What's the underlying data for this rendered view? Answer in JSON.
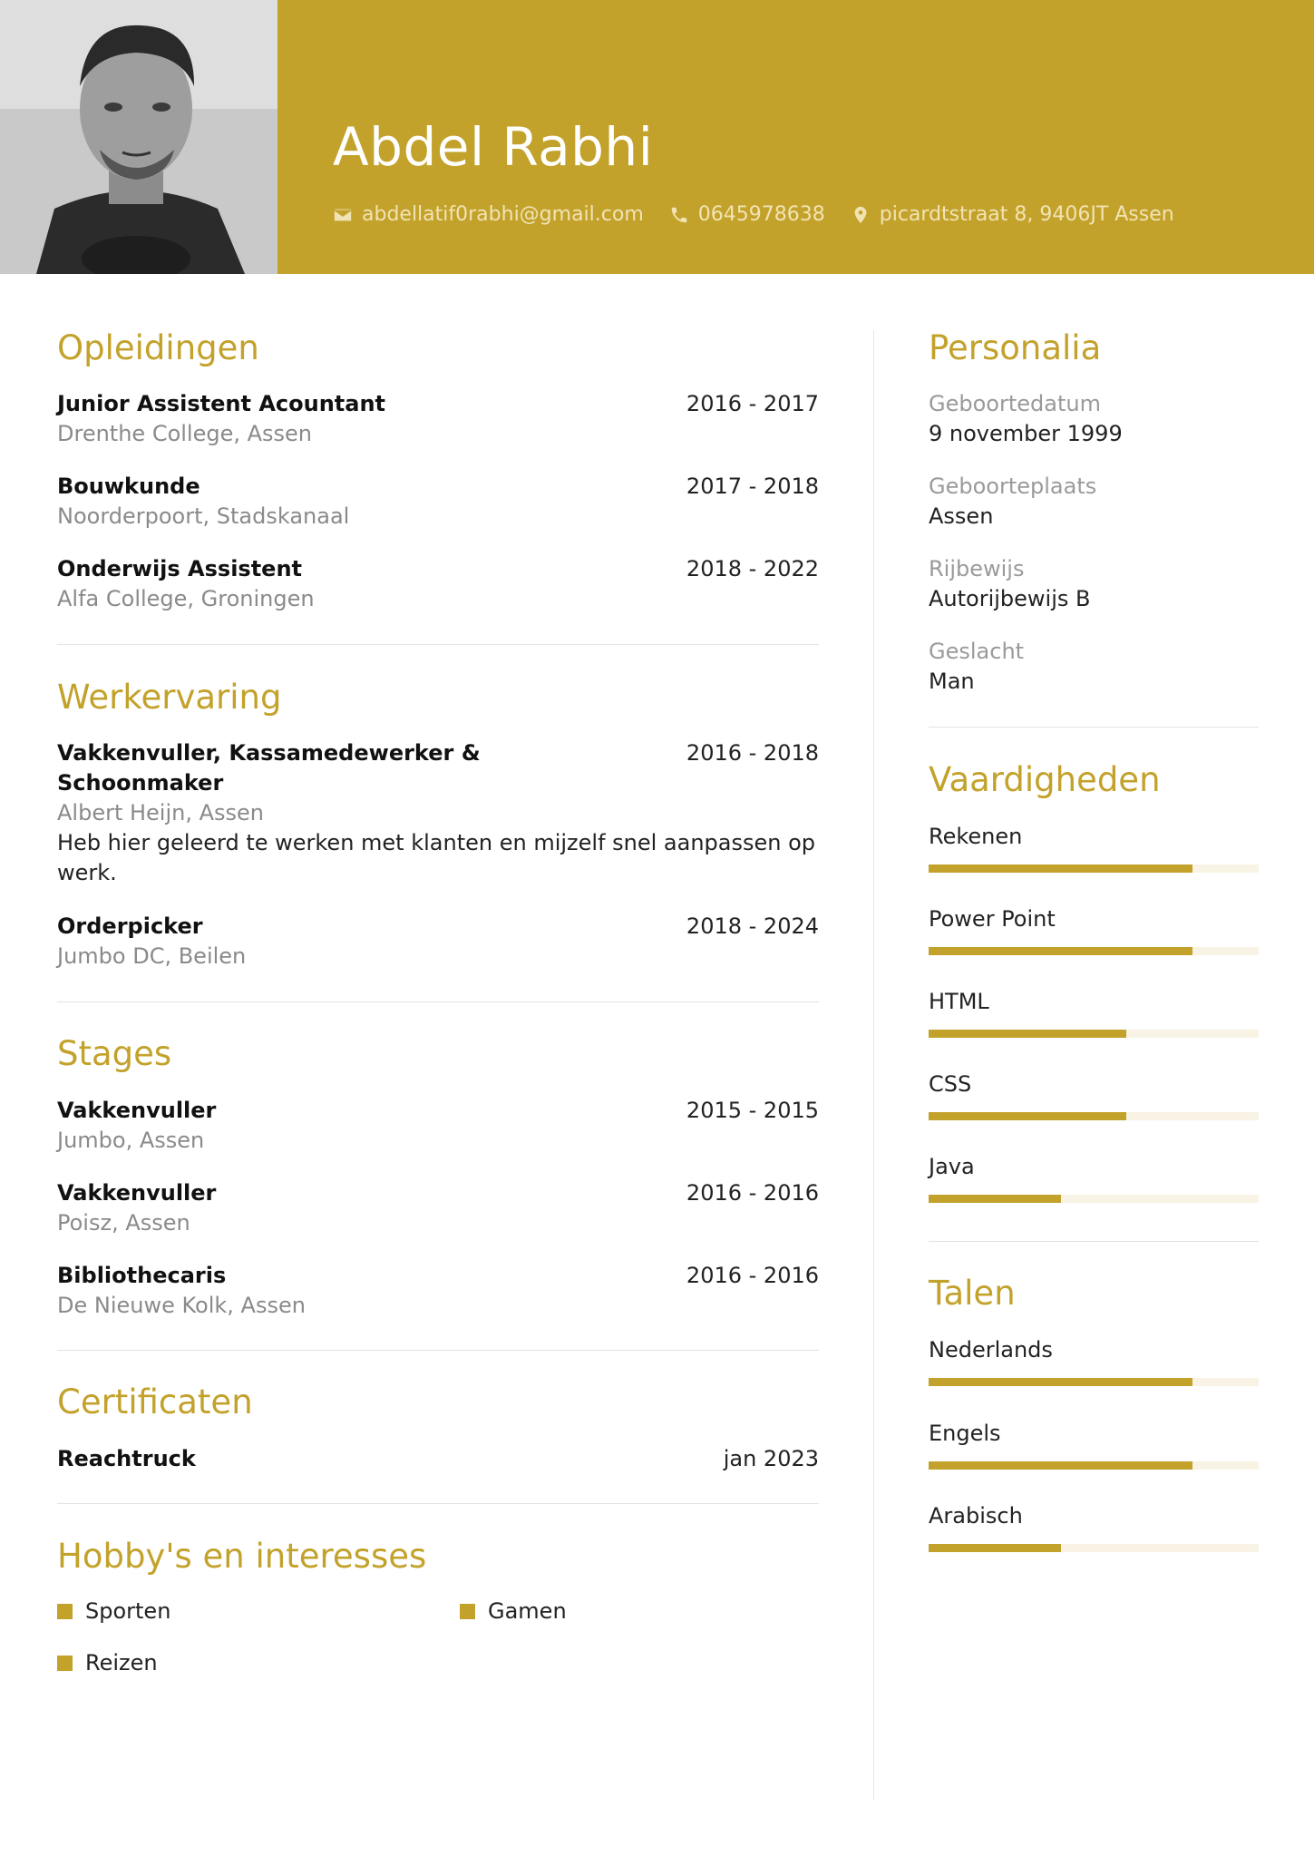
{
  "header": {
    "name": "Abdel Rabhi",
    "photo_alt": "profile-photo",
    "email": "abdellatif0rabhi@gmail.com",
    "phone": "0645978638",
    "address": "picardtstraat 8, 9406JT Assen"
  },
  "colors": {
    "accent": "#c3a22b",
    "bar_track": "#f8f3e4",
    "muted_text": "#8a8a8a"
  },
  "opleidingen": {
    "title": "Opleidingen",
    "items": [
      {
        "title": "Junior Assistent Acountant",
        "date": "2016 - 2017",
        "sub": "Drenthe College, Assen"
      },
      {
        "title": "Bouwkunde",
        "date": "2017 - 2018",
        "sub": "Noorderpoort, Stadskanaal"
      },
      {
        "title": "Onderwijs Assistent",
        "date": "2018 - 2022",
        "sub": "Alfa College, Groningen"
      }
    ]
  },
  "werkervaring": {
    "title": "Werkervaring",
    "items": [
      {
        "title_line1": "Vakkenvuller, Kassamedewerker &",
        "title_line2": "Schoonmaker",
        "date": "2016 - 2018",
        "sub": "Albert Heijn, Assen",
        "desc_line1": "Heb hier geleerd te werken met klanten en mijzelf snel aanpassen op",
        "desc_line2": "werk."
      },
      {
        "title": "Orderpicker",
        "date": "2018 - 2024",
        "sub": "Jumbo DC, Beilen"
      }
    ]
  },
  "stages": {
    "title": "Stages",
    "items": [
      {
        "title": "Vakkenvuller",
        "date": "2015 - 2015",
        "sub": "Jumbo, Assen"
      },
      {
        "title": "Vakkenvuller",
        "date": "2016 - 2016",
        "sub": "Poisz, Assen"
      },
      {
        "title": "Bibliothecaris",
        "date": "2016 - 2016",
        "sub": "De Nieuwe Kolk, Assen"
      }
    ]
  },
  "certificaten": {
    "title": "Certificaten",
    "items": [
      {
        "title": "Reachtruck",
        "date": "jan 2023"
      }
    ]
  },
  "hobbys": {
    "title": "Hobby's en interesses",
    "items": [
      "Sporten",
      "Gamen",
      "Reizen"
    ]
  },
  "personalia": {
    "title": "Personalia",
    "items": [
      {
        "label": "Geboortedatum",
        "value": "9 november 1999"
      },
      {
        "label": "Geboorteplaats",
        "value": "Assen"
      },
      {
        "label": "Rijbewijs",
        "value": "Autorijbewijs B"
      },
      {
        "label": "Geslacht",
        "value": "Man"
      }
    ]
  },
  "vaardigheden": {
    "title": "Vaardigheden",
    "items": [
      {
        "name": "Rekenen",
        "level": 0.8
      },
      {
        "name": "Power Point",
        "level": 0.8
      },
      {
        "name": "HTML",
        "level": 0.6
      },
      {
        "name": "CSS",
        "level": 0.6
      },
      {
        "name": "Java",
        "level": 0.4
      }
    ]
  },
  "talen": {
    "title": "Talen",
    "items": [
      {
        "name": "Nederlands",
        "level": 0.8
      },
      {
        "name": "Engels",
        "level": 0.8
      },
      {
        "name": "Arabisch",
        "level": 0.4
      }
    ]
  }
}
